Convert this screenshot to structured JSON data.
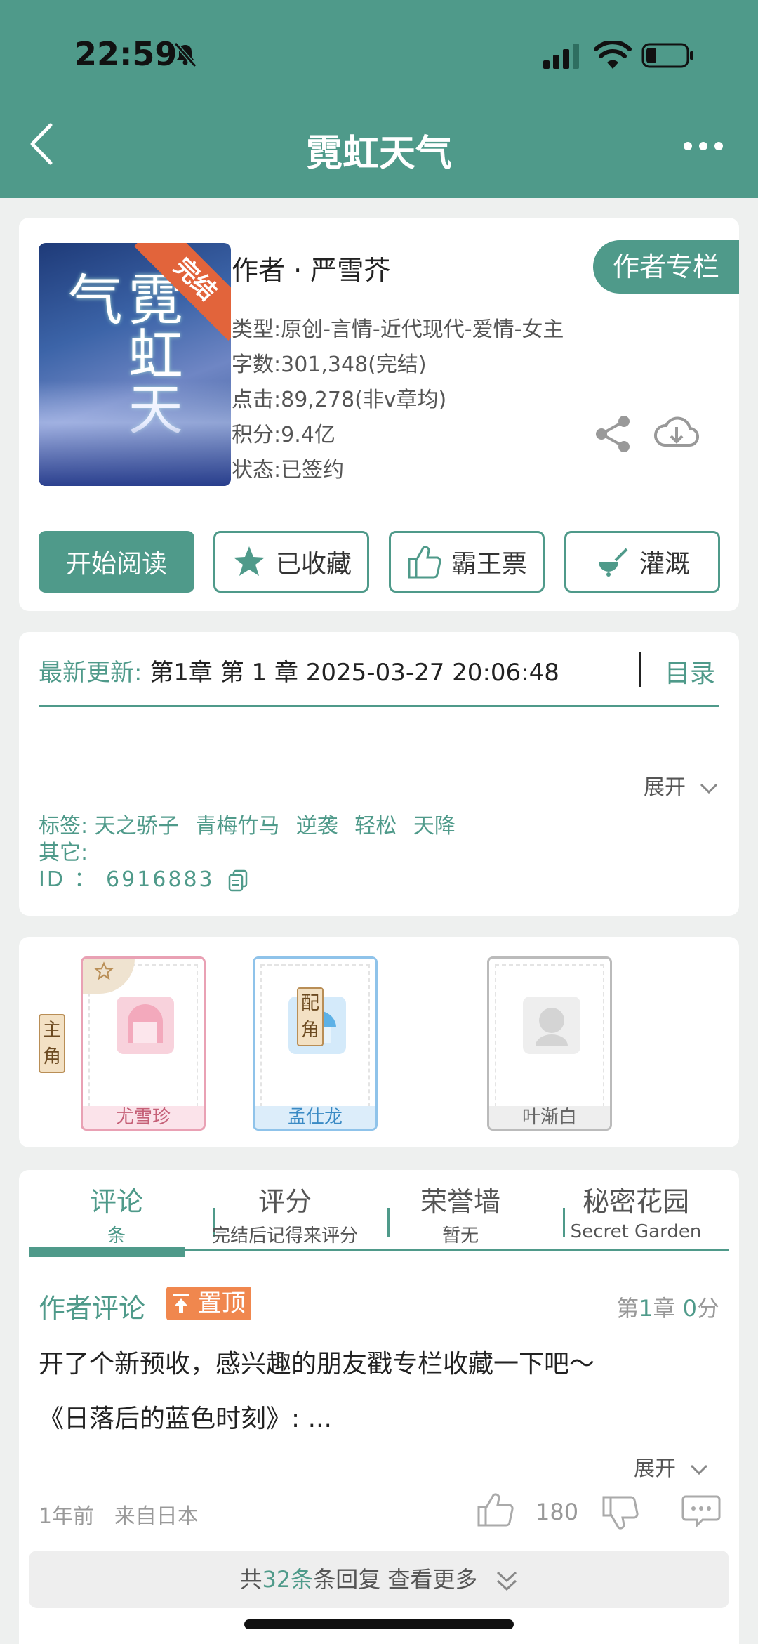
{
  "status_bar": {
    "time": "22:59"
  },
  "header": {
    "title": "霓虹天气"
  },
  "book": {
    "cover_title": "霓虹天气",
    "ribbon": "完结",
    "author": "作者 · 严雪芥",
    "author_column_label": "作者专栏",
    "type": "类型:原创-言情-近代现代-爱情-女主",
    "word_count": "字数:301,348(完结)",
    "clicks": "点击:89,278(非v章均)",
    "points": "积分:9.4亿",
    "status": "状态:已签约"
  },
  "actions": {
    "start_reading": "开始阅读",
    "favorited": "已收藏",
    "overlord_ticket": "霸王票",
    "water": "灌溉"
  },
  "update": {
    "label": "最新更新:",
    "value": "第1章 第 1 章 2025-03-27 20:06:48",
    "toc": "目录",
    "expand": "展开"
  },
  "tags": {
    "label": "标签:",
    "items": [
      "天之骄子",
      "青梅竹马",
      "逆袭",
      "轻松",
      "天降"
    ],
    "other_label": "其它:",
    "id_line": "ID ： 6916883"
  },
  "characters": {
    "lead_label": "主角",
    "support_label": "配角",
    "items": [
      {
        "name": "尤雪珍"
      },
      {
        "name": "孟仕龙"
      },
      {
        "name": "叶渐白"
      }
    ]
  },
  "tabs": [
    {
      "label": "评论",
      "sub": "条"
    },
    {
      "label": "评分",
      "sub": "完结后记得来评分"
    },
    {
      "label": "荣誉墙",
      "sub": "暂无"
    },
    {
      "label": "秘密花园",
      "sub": "Secret Garden"
    }
  ],
  "comment": {
    "title": "作者评论",
    "pin": "置顶",
    "chapter_prefix": "第",
    "chapter_num": "1",
    "chapter_mid": "章",
    "score": "0",
    "score_unit": "分",
    "line1": "开了个新预收，感兴趣的朋友戳专栏收藏一下吧～",
    "line2": "《日落后的蓝色时刻》: ...",
    "expand": "展开",
    "time": "1年前",
    "location": "来自日本",
    "likes": "180",
    "more_prefix": "共",
    "more_count": "32",
    "more_suffix": "条回复 查看更多"
  },
  "colors": {
    "accent": "#4f9a8a",
    "ribbon": "#e2643b",
    "pin": "#f0874e"
  }
}
